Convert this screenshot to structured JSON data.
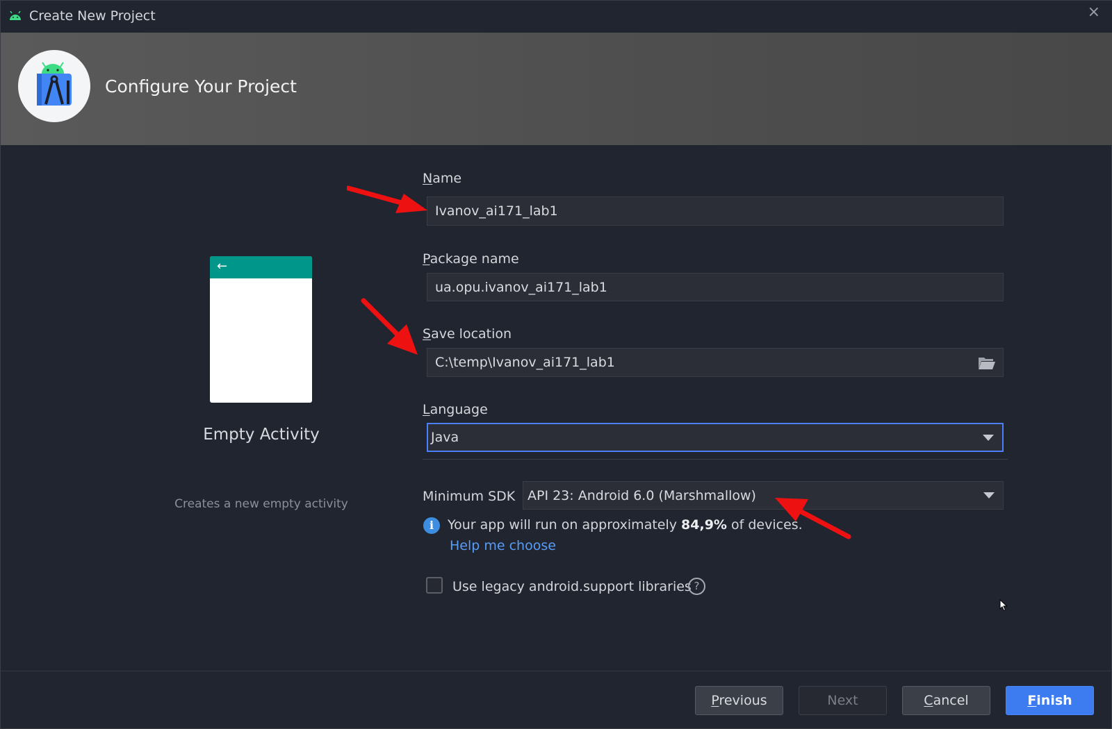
{
  "window": {
    "title": "Create New Project",
    "close_glyph": "×"
  },
  "header": {
    "heading": "Configure Your Project",
    "logo_icon": "android-studio-logo-icon"
  },
  "preview": {
    "template_name": "Empty Activity",
    "template_description": "Creates a new empty activity",
    "back_glyph": "←"
  },
  "form": {
    "name": {
      "label_first": "N",
      "label_rest": "ame",
      "value": "Ivanov_ai171_lab1"
    },
    "package": {
      "label_first": "P",
      "label_rest": "ackage name",
      "value": "ua.opu.ivanov_ai171_lab1"
    },
    "save_location": {
      "label_first": "S",
      "label_rest": "ave location",
      "value": "C:\\temp\\Ivanov_ai171_lab1",
      "icon": "folder-open-icon"
    },
    "language": {
      "label_first": "L",
      "label_rest": "anguage",
      "value": "Java"
    },
    "min_sdk": {
      "label": "Minimum SDK",
      "value": "API 23: Android 6.0 (Marshmallow)"
    },
    "info": {
      "prefix": "Your app will run on approximately ",
      "percent": "84,9%",
      "suffix": " of devices.",
      "link": "Help me choose"
    },
    "legacy": {
      "label": "Use legacy android.support libraries",
      "checked": false,
      "help_glyph": "?"
    }
  },
  "buttons": {
    "previous": {
      "first": "P",
      "rest": "revious"
    },
    "next": "Next",
    "cancel": {
      "first": "C",
      "rest": "ancel"
    },
    "finish": {
      "first": "F",
      "rest": "inish"
    }
  },
  "colors": {
    "accent": "#3d7bf0",
    "link": "#589df6",
    "preview_bar": "#00968a",
    "annotation_arrow": "#ee1111"
  }
}
